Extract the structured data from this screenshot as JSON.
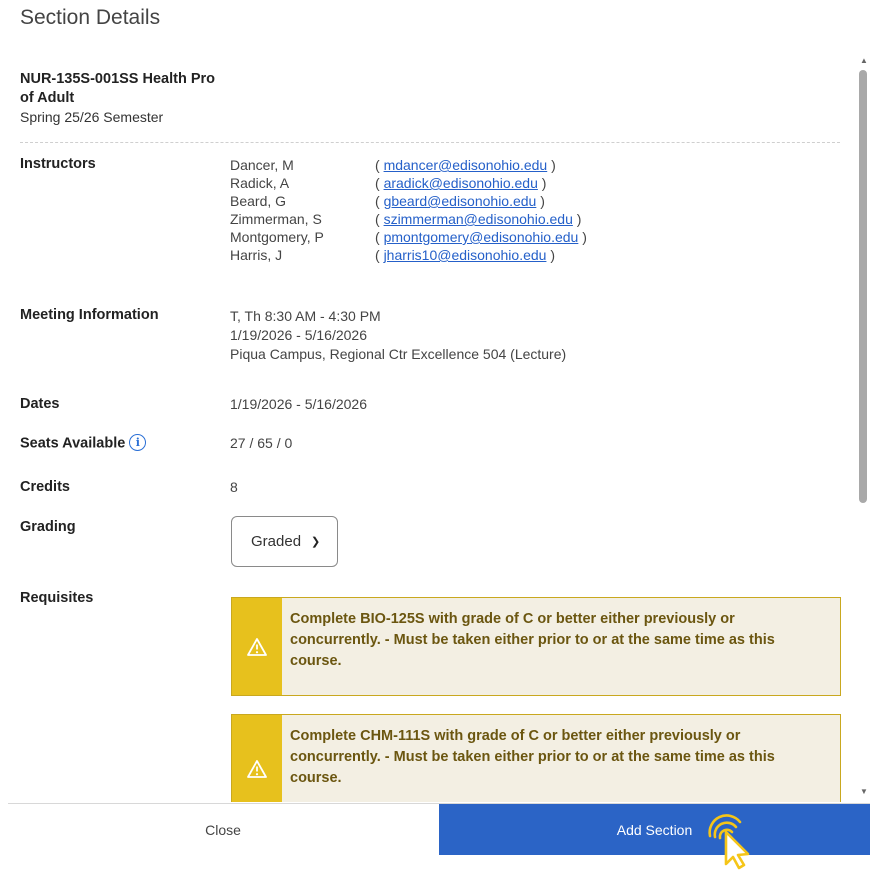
{
  "dialog": {
    "title": "Section Details"
  },
  "course": {
    "code_title": "NUR-135S-001SS Health Pro of Adult",
    "term": "Spring 25/26 Semester"
  },
  "instructors": {
    "label": "Instructors",
    "items": [
      {
        "name": "Dancer, M",
        "open": "( ",
        "email": "mdancer@edisonohio.edu",
        "close": " )"
      },
      {
        "name": "Radick, A",
        "open": "( ",
        "email": "aradick@edisonohio.edu",
        "close": " )"
      },
      {
        "name": "Beard, G",
        "open": "( ",
        "email": "gbeard@edisonohio.edu",
        "close": " )"
      },
      {
        "name": "Zimmerman, S",
        "open": "( ",
        "email": "szimmerman@edisonohio.edu",
        "close": " )"
      },
      {
        "name": "Montgomery, P",
        "open": "( ",
        "email": "pmontgomery@edisonohio.edu",
        "close": " )"
      },
      {
        "name": "Harris, J",
        "open": "( ",
        "email": "jharris10@edisonohio.edu",
        "close": " )"
      }
    ]
  },
  "meeting": {
    "label": "Meeting Information",
    "lines": [
      "T, Th 8:30 AM - 4:30 PM",
      "1/19/2026 - 5/16/2026",
      "Piqua Campus, Regional Ctr Excellence 504 (Lecture)"
    ]
  },
  "dates": {
    "label": "Dates",
    "value": "1/19/2026 - 5/16/2026"
  },
  "seats": {
    "label": "Seats Available",
    "value": "27 / 65 / 0",
    "info_icon": "info-icon"
  },
  "credits": {
    "label": "Credits",
    "value": "8"
  },
  "grading": {
    "label": "Grading",
    "selected": "Graded"
  },
  "requisites": {
    "label": "Requisites",
    "items": [
      {
        "text": "Complete BIO-125S with grade of C or better either previously or concurrently. - Must be taken either prior to or at the same time as this course.",
        "icon": "warning-icon"
      },
      {
        "text": "Complete CHM-111S with grade of C or better either previously or concurrently. - Must be taken either prior to or at the same time as this course.",
        "icon": "warning-icon"
      }
    ]
  },
  "footer": {
    "close_label": "Close",
    "add_label": "Add Section"
  },
  "colors": {
    "primary": "#2b64c6",
    "warning_bar": "#e7c11d",
    "warning_bg": "#f3efe3",
    "warning_text": "#6b5610",
    "link": "#2560c9",
    "cursor": "#f5c518"
  }
}
